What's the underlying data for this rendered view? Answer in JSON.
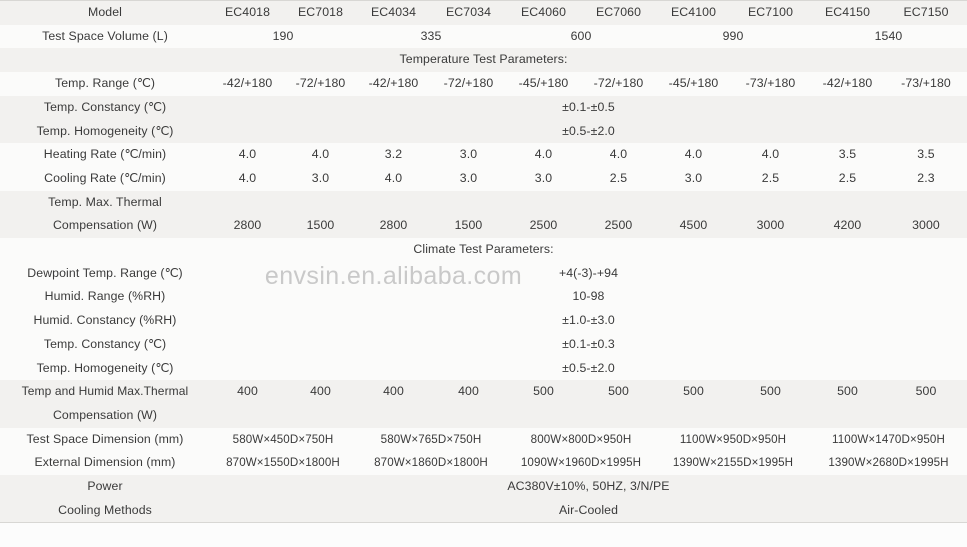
{
  "watermark": "envsin.en.alibaba.com",
  "columns": [
    "EC4018",
    "EC7018",
    "EC4034",
    "EC7034",
    "EC4060",
    "EC7060",
    "EC4100",
    "EC7100",
    "EC4150",
    "EC7150"
  ],
  "rows": {
    "model_label": "Model",
    "volume_label": "Test Space Volume (L)",
    "volume_values": [
      "190",
      "335",
      "600",
      "990",
      "1540"
    ],
    "temp_section_label": "Temperature Test Parameters:",
    "temp_range_label": "Temp. Range (℃)",
    "temp_range_values": [
      "-42/+180",
      "-72/+180",
      "-42/+180",
      "-72/+180",
      "-45/+180",
      "-72/+180",
      "-45/+180",
      "-73/+180",
      "-42/+180",
      "-73/+180"
    ],
    "temp_constancy_label": "Temp. Constancy (℃)",
    "temp_constancy_value": "±0.1-±0.5",
    "temp_homogeneity_label": "Temp. Homogeneity (℃)",
    "temp_homogeneity_value": "±0.5-±2.0",
    "heating_rate_label": "Heating Rate (℃/min)",
    "heating_rate_values": [
      "4.0",
      "4.0",
      "3.2",
      "3.0",
      "4.0",
      "4.0",
      "4.0",
      "4.0",
      "3.5",
      "3.5"
    ],
    "cooling_rate_label": "Cooling Rate (℃/min)",
    "cooling_rate_values": [
      "4.0",
      "3.0",
      "4.0",
      "3.0",
      "3.0",
      "2.5",
      "3.0",
      "2.5",
      "2.5",
      "2.3"
    ],
    "temp_max_thermal_label_1": "Temp. Max. Thermal",
    "temp_max_thermal_label_2": "Compensation (W)",
    "temp_max_thermal_values": [
      "2800",
      "1500",
      "2800",
      "1500",
      "2500",
      "2500",
      "4500",
      "3000",
      "4200",
      "3000"
    ],
    "climate_section_label": "Climate Test Parameters:",
    "dewpoint_label": "Dewpoint Temp. Range (℃)",
    "dewpoint_value": "+4(-3)-+94",
    "humid_range_label": "Humid. Range (%RH)",
    "humid_range_value": "10-98",
    "humid_constancy_label": "Humid. Constancy (%RH)",
    "humid_constancy_value": "±1.0-±3.0",
    "climate_temp_constancy_label": "Temp. Constancy (℃)",
    "climate_temp_constancy_value": "±0.1-±0.3",
    "climate_temp_homogeneity_label": "Temp. Homogeneity (℃)",
    "climate_temp_homogeneity_value": "±0.5-±2.0",
    "temp_humid_thermal_label_1": "Temp and Humid Max.Thermal",
    "temp_humid_thermal_label_2": "Compensation (W)",
    "temp_humid_thermal_values": [
      "400",
      "400",
      "400",
      "400",
      "500",
      "500",
      "500",
      "500",
      "500",
      "500"
    ],
    "test_space_dim_label": "Test Space Dimension (mm)",
    "test_space_dim_values": [
      "580W×450D×750H",
      "580W×765D×750H",
      "800W×800D×950H",
      "1100W×950D×950H",
      "1100W×1470D×950H"
    ],
    "external_dim_label": "External Dimension (mm)",
    "external_dim_values": [
      "870W×1550D×1800H",
      "870W×1860D×1800H",
      "1090W×1960D×1995H",
      "1390W×2155D×1995H",
      "1390W×2680D×1995H"
    ],
    "power_label": "Power",
    "power_value": "AC380V±10%, 50HZ, 3/N/PE",
    "cooling_methods_label": "Cooling Methods",
    "cooling_methods_value": "Air-Cooled"
  }
}
